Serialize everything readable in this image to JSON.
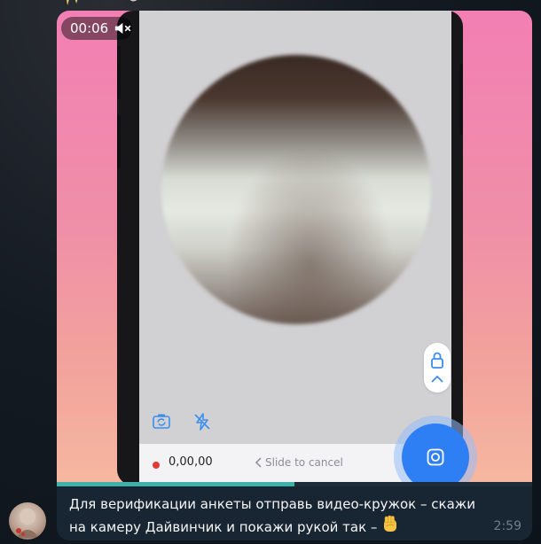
{
  "video": {
    "duration": "00:06",
    "progress_percent": 50,
    "recording_time": "0,00,00",
    "slide_to_cancel": "Slide to cancel"
  },
  "message": {
    "text": "Для верификации анкеты отправь видео-кружок – скажи на камеру Дайвинчик и покажи рукой так –",
    "emoji": "✊",
    "time": "2:59"
  },
  "icons": {
    "mute": "muted-speaker-icon",
    "lock": "lock-icon",
    "chevron": "chevron-up-icon",
    "flip_camera": "flip-camera-icon",
    "flash_off": "flash-off-icon",
    "record": "record-camera-icon"
  },
  "colors": {
    "accent": "#2f7ff4",
    "progress": "#3eb1a8",
    "bubble": "#182533",
    "record_dot": "#e53935"
  }
}
